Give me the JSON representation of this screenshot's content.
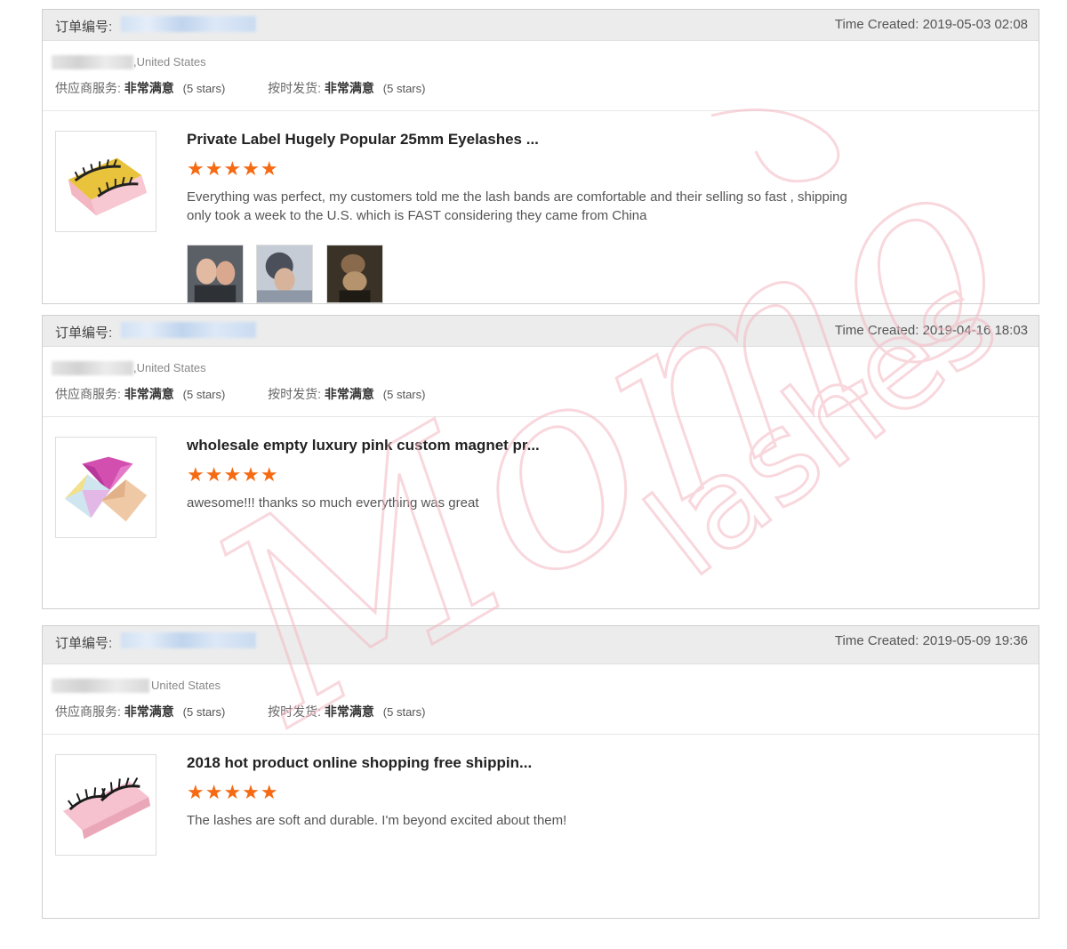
{
  "reviews": [
    {
      "order_label": "订单编号:",
      "time_created": "Time Created: 2019-05-03 02:08",
      "country": ",United States",
      "supplier_service_label": "供应商服务:",
      "supplier_service_value": "非常满意",
      "supplier_service_stars": "(5 stars)",
      "shipping_label": "按时发货:",
      "shipping_value": "非常满意",
      "shipping_stars": "(5 stars)",
      "product_title": "Private Label Hugely Popular 25mm Eyelashes ...",
      "rating_stars": "★★★★★",
      "review_text": "Everything was perfect, my customers told me the lash bands are comfortable and their selling so fast , shipping only took a week to the U.S. which is FAST considering they came from China",
      "thumb_icon": "lash-box-gold-icon",
      "photos": [
        "selfie-photo-icon",
        "car-selfie-photo-icon",
        "group-photo-icon"
      ]
    },
    {
      "order_label": "订单编号:",
      "time_created": "Time Created: 2019-04-16 18:03",
      "country": ",United States",
      "supplier_service_label": "供应商服务:",
      "supplier_service_value": "非常满意",
      "supplier_service_stars": "(5 stars)",
      "shipping_label": "按时发货:",
      "shipping_value": "非常满意",
      "shipping_stars": "(5 stars)",
      "product_title": "wholesale empty luxury pink custom magnet pr...",
      "rating_stars": "★★★★★",
      "review_text": "awesome!!! thanks so much everything was great",
      "thumb_icon": "diamond-box-icon"
    },
    {
      "order_label": "订单编号:",
      "time_created": "Time Created: 2019-05-09 19:36",
      "country": "United States",
      "supplier_service_label": "供应商服务:",
      "supplier_service_value": "非常满意",
      "supplier_service_stars": "(5 stars)",
      "shipping_label": "按时发货:",
      "shipping_value": "非常满意",
      "shipping_stars": "(5 stars)",
      "product_title": "2018 hot product online shopping free shippin...",
      "rating_stars": "★★★★★",
      "review_text": "The lashes are soft and durable. I'm beyond excited about them!",
      "thumb_icon": "lash-box-pink-icon"
    }
  ],
  "watermark": {
    "line1": "Momo",
    "line2": "lashes",
    "color": "#f7c5cc"
  },
  "colors": {
    "star": "#f56a12",
    "header_bg": "#ececec",
    "border": "#cfcfcf"
  }
}
